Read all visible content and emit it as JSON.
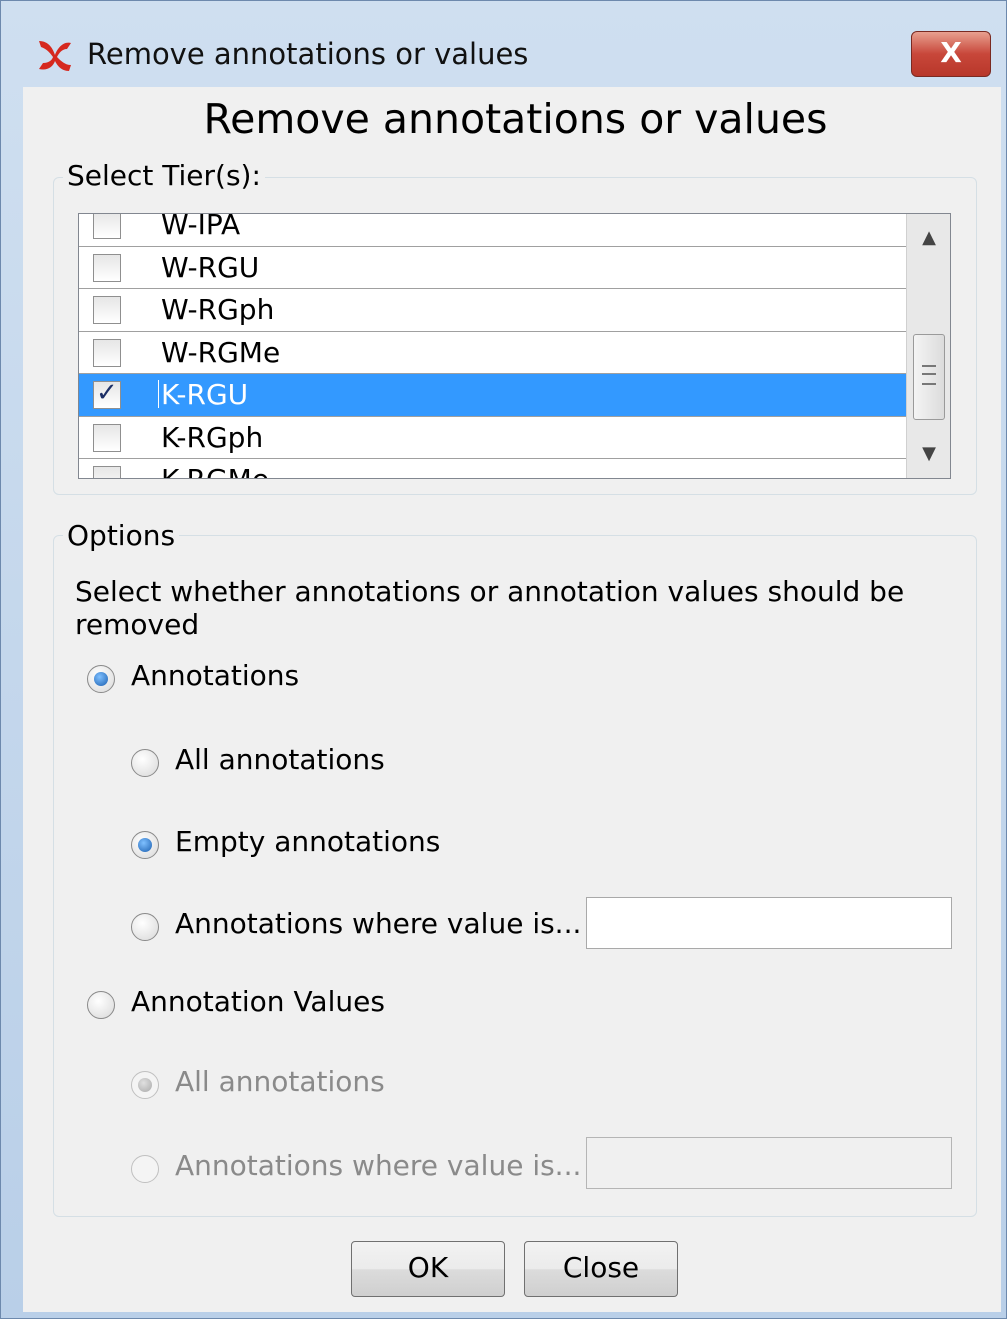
{
  "window": {
    "title": "Remove annotations or values",
    "close_label": "X"
  },
  "heading": "Remove annotations or values",
  "tiers": {
    "group_label": "Select Tier(s):",
    "items": [
      {
        "label": "W-IPA",
        "checked": false
      },
      {
        "label": "W-RGU",
        "checked": false
      },
      {
        "label": "W-RGph",
        "checked": false
      },
      {
        "label": "W-RGMe",
        "checked": false
      },
      {
        "label": "K-RGU",
        "checked": true,
        "selected": true
      },
      {
        "label": "K-RGph",
        "checked": false
      },
      {
        "label": "K-RGMe",
        "checked": false
      }
    ]
  },
  "options": {
    "group_label": "Options",
    "description": "Select whether annotations or annotation values should be removed",
    "annotations_label": "Annotations",
    "all_annotations_label": "All annotations",
    "empty_annotations_label": "Empty annotations",
    "where_value_label": "Annotations where value is...",
    "where_value_input": "",
    "annotation_values_label": "Annotation Values",
    "values_all_annotations_label": "All annotations",
    "values_where_value_label": "Annotations where value is...",
    "values_where_value_input": ""
  },
  "buttons": {
    "ok": "OK",
    "close": "Close"
  },
  "colors": {
    "selection": "#3399ff",
    "close_button": "#c8473a"
  }
}
